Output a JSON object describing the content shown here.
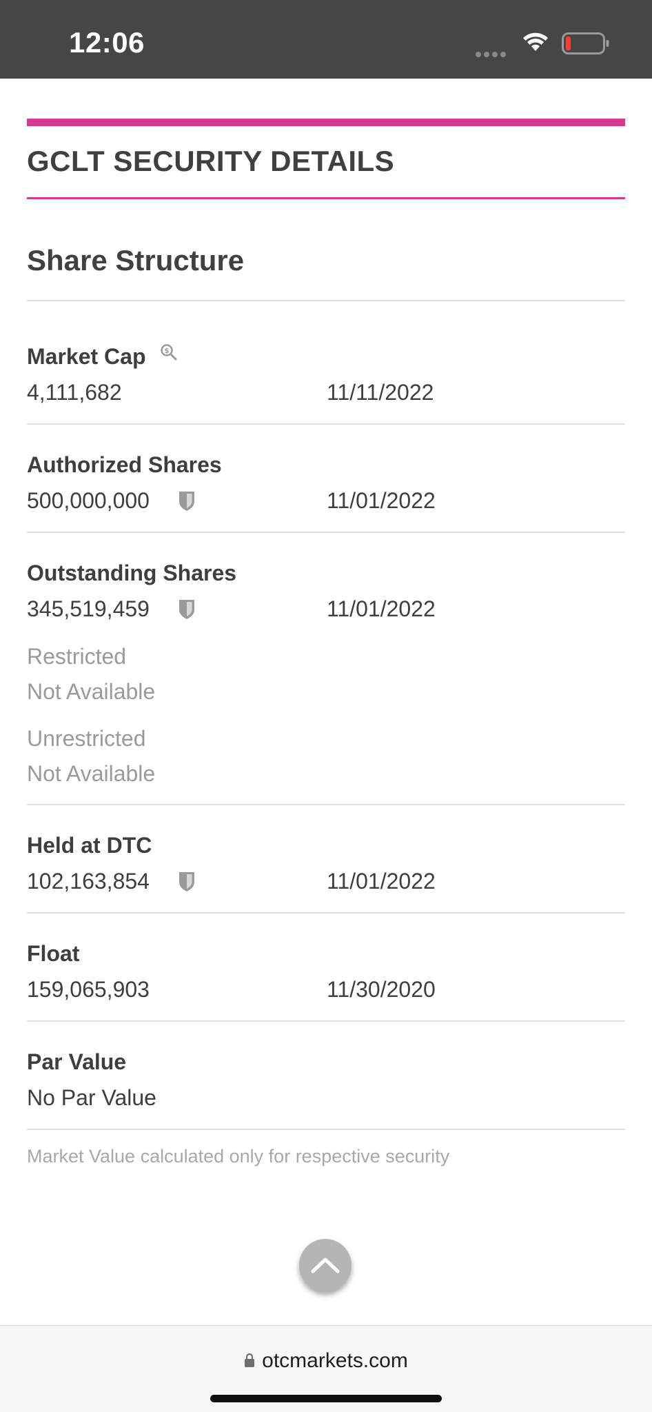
{
  "status_bar": {
    "time": "12:06"
  },
  "page": {
    "section_title": "GCLT SECURITY DETAILS",
    "subsection_title": "Share Structure",
    "accent_color": "#d6398f"
  },
  "fields": {
    "market_cap": {
      "label": "Market Cap",
      "value": "4,111,682",
      "date": "11/11/2022"
    },
    "authorized_shares": {
      "label": "Authorized Shares",
      "value": "500,000,000",
      "date": "11/01/2022"
    },
    "outstanding_shares": {
      "label": "Outstanding Shares",
      "value": "345,519,459",
      "date": "11/01/2022",
      "restricted_label": "Restricted",
      "restricted_value": "Not Available",
      "unrestricted_label": "Unrestricted",
      "unrestricted_value": "Not Available"
    },
    "held_at_dtc": {
      "label": "Held at DTC",
      "value": "102,163,854",
      "date": "11/01/2022"
    },
    "float": {
      "label": "Float",
      "value": "159,065,903",
      "date": "11/30/2020"
    },
    "par_value": {
      "label": "Par Value",
      "value": "No Par Value"
    }
  },
  "footnote": "Market Value calculated only for respective security",
  "browser": {
    "url": "otcmarkets.com"
  },
  "icons": {
    "verified": "shield-icon",
    "market_cap_info": "magnify-dollar-icon",
    "scroll_top": "chevron-up-icon",
    "secure": "lock-icon"
  }
}
